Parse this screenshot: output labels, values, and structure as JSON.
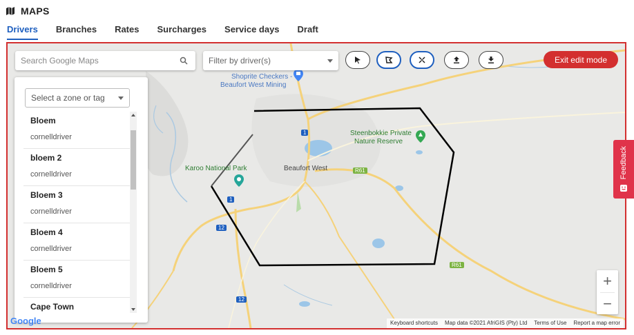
{
  "app": {
    "title": "MAPS"
  },
  "tabs": [
    {
      "label": "Drivers",
      "active": true
    },
    {
      "label": "Branches",
      "active": false
    },
    {
      "label": "Rates",
      "active": false
    },
    {
      "label": "Surcharges",
      "active": false
    },
    {
      "label": "Service days",
      "active": false
    },
    {
      "label": "Draft",
      "active": false
    }
  ],
  "search": {
    "placeholder": "Search Google Maps",
    "value": ""
  },
  "driver_filter": {
    "placeholder": "Filter by driver(s)"
  },
  "toolbar": {
    "tools": [
      {
        "name": "pointer-icon",
        "selected": false
      },
      {
        "name": "polygon-draw-icon",
        "selected": true
      },
      {
        "name": "edit-points-icon",
        "selected": true
      },
      {
        "name": "upload-icon",
        "selected": false
      },
      {
        "name": "download-icon",
        "selected": false
      }
    ],
    "exit_label": "Exit edit mode"
  },
  "zone_panel": {
    "select_placeholder": "Select a zone or tag",
    "zones": [
      {
        "name": "Bloem",
        "driver": "cornelldriver"
      },
      {
        "name": "bloem 2",
        "driver": "cornelldriver"
      },
      {
        "name": "Bloem 3",
        "driver": "cornelldriver"
      },
      {
        "name": "Bloem 4",
        "driver": "cornelldriver"
      },
      {
        "name": "Bloem 5",
        "driver": "cornelldriver"
      },
      {
        "name": "Cape Town",
        "driver": ""
      }
    ]
  },
  "map": {
    "labels": {
      "shoprite": "Shoprite Checkers -",
      "shoprite2": "Beaufort West Mining",
      "steenbokkie": "Steenbokkie Private",
      "steenbokkie2": "Nature Reserve",
      "karoo": "Karoo National Park",
      "beaufort": "Beaufort West",
      "r61": "R61",
      "r61b": "R61",
      "n1a": "1",
      "n1b": "1",
      "n12a": "12",
      "n12b": "12"
    },
    "attribution": [
      "Keyboard shortcuts",
      "Map data ©2021 AfriGIS (Pty) Ltd",
      "Terms of Use",
      "Report a map error"
    ],
    "google_logo": "Google"
  },
  "zoom": {
    "in": "+",
    "out": "−"
  },
  "feedback": {
    "label": "Feedback"
  },
  "colors": {
    "accent": "#1e5fbf",
    "danger": "#d32f2f",
    "feedback": "#e0334a",
    "road": "#f5d27a",
    "water": "#9cc6e8",
    "park": "#34a853"
  }
}
